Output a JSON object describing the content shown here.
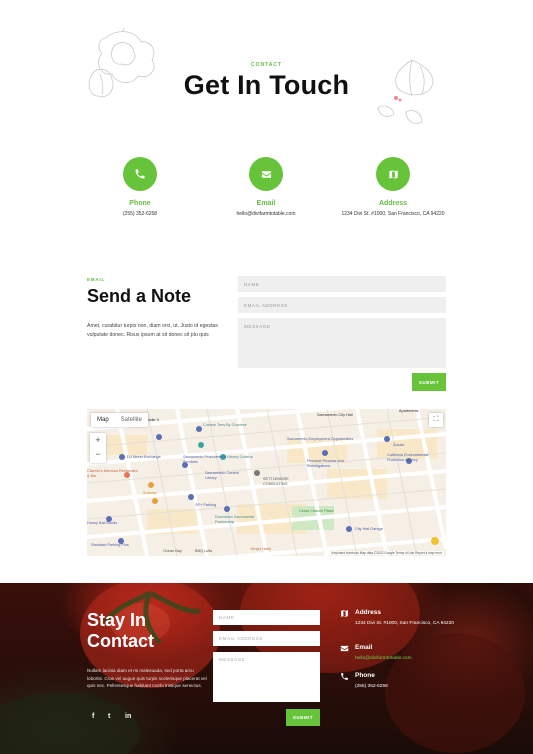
{
  "header": {
    "eyebrow": "CONTACT",
    "title": "Get In Touch"
  },
  "contact_cards": [
    {
      "icon": "phone-icon",
      "label": "Phone",
      "value": "(255) 352-6258"
    },
    {
      "icon": "envelope-icon",
      "label": "Email",
      "value": "hello@divifarmtotable.com"
    },
    {
      "icon": "map-icon",
      "label": "Address",
      "value": "1234 Divi St. #1000, San Francisco, CA 94220"
    }
  ],
  "note": {
    "eyebrow": "EMAIL",
    "title": "Send a Note",
    "body": "Amet, curabitur turpis non, diam orci, ut. Justo id egestas vulputate donec. Risus ipsum at sit donec sit plu quis",
    "name_placeholder": "NAME",
    "email_placeholder": "EMAIL ADDRESS",
    "message_placeholder": "MESSAGE",
    "submit_label": "SUBMIT"
  },
  "map": {
    "tab_map": "Map",
    "tab_satellite": "Satellite",
    "zoom_in": "+",
    "zoom_out": "−",
    "fullscreen": "⛶",
    "credit": "Keyboard shortcuts   Map data ©2022 Google   Terms of Use   Report a map error",
    "places": [
      "10 Pickup For Caddie X",
      "Custom Tees By Charlese",
      "Sacramento City Hall",
      "Sacramento Employment Opportunities",
      "Apartments",
      "DJ Street Exchange",
      "Sacramento Procurement Services",
      "Library Galleria",
      "Pinnacle Process and Investigations",
      "Zocalo",
      "California Environmental Protection Agency",
      "Cilantro's Mexican Restaurant & Bar",
      "Sacramento Central Library",
      "Subway",
      "SETTLEMORE CONSULTING",
      "SP+ Parking",
      "Downtown Sacramento Partnership",
      "Cesar Chavez Plaza",
      "Honey Bail Bonds",
      "City Hall Garage",
      "Standard Parking Plus",
      "King's Hotel",
      "Ocean Bay",
      "BBQ Lofts"
    ]
  },
  "footer": {
    "title_line1": "Stay In",
    "title_line2": "Contact",
    "body": "Nullam lacinia diam et mi malesuada, sed porta arcu lobortis. Cras vel augue quis turpis scelerisque placerat vel quis nec. Pellentesque habitant morbi tristique senectus.",
    "social": [
      "f",
      "t",
      "in"
    ],
    "name_placeholder": "NAME",
    "email_placeholder": "EMAIL ADDRESS",
    "message_placeholder": "MESSAGE",
    "submit_label": "SUBMIT",
    "info": [
      {
        "icon": "map-icon",
        "label": "Address",
        "value": "1234 Divi St. #1000, San Francisco, CA 94220"
      },
      {
        "icon": "envelope-icon",
        "label": "Email",
        "value": "hello@divifarmtotable.com"
      },
      {
        "icon": "phone-icon",
        "label": "Phone",
        "value": "(255) 352-6258"
      }
    ]
  },
  "colors": {
    "accent": "#66c33a",
    "heading": "#111111",
    "footer_bg": "#2a0d08"
  }
}
